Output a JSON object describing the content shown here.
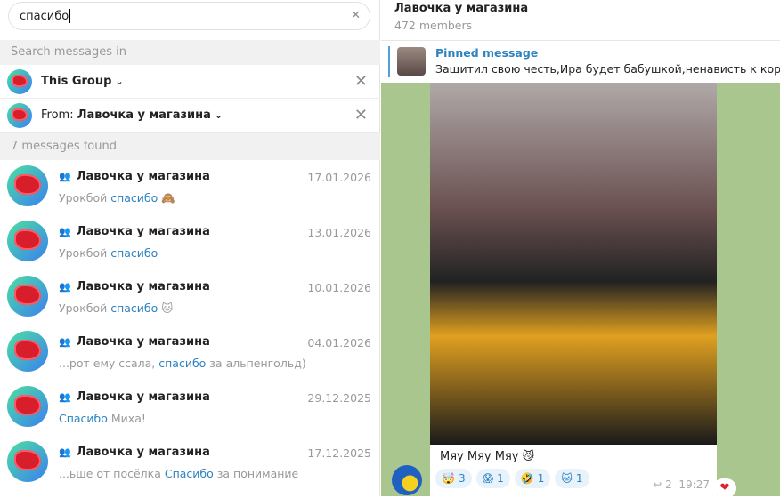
{
  "search": {
    "query": "спасибо",
    "section_label": "Search messages in"
  },
  "filters": [
    {
      "label": "This Group"
    },
    {
      "prefix": "From: ",
      "label": "Лавочка у магазина"
    }
  ],
  "found_label": "7 messages found",
  "results": [
    {
      "name": "Лавочка у магазина",
      "date": "17.01.2026",
      "before": "Урокбой ",
      "match": "спасибо",
      "after": " 🙈"
    },
    {
      "name": "Лавочка у магазина",
      "date": "13.01.2026",
      "before": "Урокбой ",
      "match": "спасибо",
      "after": ""
    },
    {
      "name": "Лавочка у магазина",
      "date": "10.01.2026",
      "before": "Урокбой ",
      "match": "спасибо",
      "after": " 🐱"
    },
    {
      "name": "Лавочка у магазина",
      "date": "04.01.2026",
      "before": "...рот ему ссала, ",
      "match": "спасибо",
      "after": " за альпенгольд)"
    },
    {
      "name": "Лавочка у магазина",
      "date": "29.12.2025",
      "before": "",
      "match": "Спасибо",
      "after": " Миха!"
    },
    {
      "name": "Лавочка у магазина",
      "date": "17.12.2025",
      "before": "...ьше от посёлка ",
      "match": "Спасибо",
      "after": " за понимание"
    }
  ],
  "chat": {
    "title": "Лавочка у магазина",
    "members": "472 members",
    "pinned_title": "Pinned message",
    "pinned_text": "Защитил свою честь,Ира будет бабушкой,ненависть к кормящ",
    "caption": "Мяу Мяу Мяу 😼",
    "reactions": [
      {
        "emoji": "🤯",
        "count": "3"
      },
      {
        "emoji": "😱",
        "count": "1"
      },
      {
        "emoji": "🤣",
        "count": "1"
      },
      {
        "emoji": "🐱",
        "count": "1"
      }
    ],
    "replies": "2",
    "time": "19:27",
    "my_reaction": "❤"
  }
}
